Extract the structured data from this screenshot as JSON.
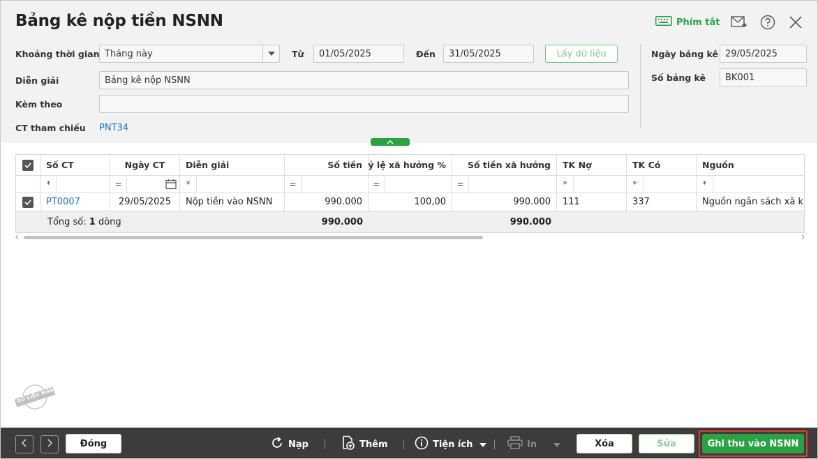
{
  "header": {
    "title": "Bảng kê nộp tiền NSNN",
    "shortcut_label": "Phím tắt"
  },
  "form": {
    "period_label": "Khoảng thời gian",
    "period_value": "Tháng này",
    "from_label": "Từ",
    "from_value": "01/05/2025",
    "to_label": "Đến",
    "to_value": "31/05/2025",
    "fetch_label": "Lấy dữ liệu",
    "description_label": "Diễn giải",
    "description_value": "Bảng kê nộp NSNN",
    "attach_label": "Kèm theo",
    "attach_value": "",
    "ref_label": "CT tham chiếu",
    "ref_value": "PNT34",
    "list_date_label": "Ngày bảng kê",
    "list_date_value": "29/05/2025",
    "list_no_label": "Số bảng kê",
    "list_no_value": "BK001"
  },
  "grid": {
    "columns": [
      "Số CT",
      "Ngày CT",
      "Diễn giải",
      "Số tiền",
      "Tỷ lệ xã hưởng %",
      "Số tiền xã hưởng",
      "TK Nợ",
      "TK Có",
      "Nguồn"
    ],
    "filter_ops": [
      "*",
      "=",
      "*",
      "=",
      "=",
      "=",
      "*",
      "*",
      "*"
    ],
    "rows": [
      {
        "so_ct": "PT0007",
        "ngay_ct": "29/05/2025",
        "dien_giai": "Nộp tiền vào NSNN",
        "so_tien": "990.000",
        "ty_le": "100,00",
        "so_tien_xa_huong": "990.000",
        "tk_no": "111",
        "tk_co": "337",
        "nguon": "Nguồn ngân sách xã kho"
      }
    ],
    "footer": {
      "total_prefix": "Tổng số: ",
      "total_count": "1",
      "total_suffix": " dòng",
      "sum_so_tien": "990.000",
      "sum_xa_huong": "990.000"
    }
  },
  "stamp_text": "DỮ LIỆU MẪU",
  "toolbar": {
    "close_label": "Đóng",
    "reload_label": "Nạp",
    "add_label": "Thêm",
    "utility_label": "Tiện ích",
    "print_label": "In",
    "delete_label": "Xóa",
    "edit_label": "Sửa",
    "record_label": "Ghi thu vào NSNN"
  },
  "colors": {
    "accent": "#2aa244",
    "link": "#1a73c8",
    "toolbar_bg": "#3c3c3c",
    "highlight": "#e53935"
  }
}
